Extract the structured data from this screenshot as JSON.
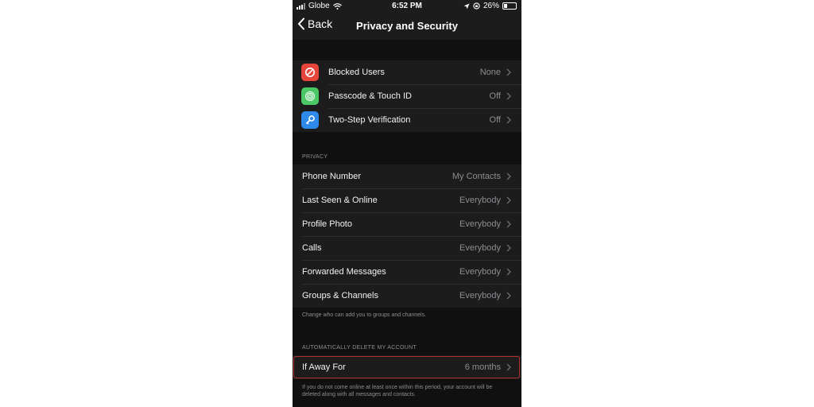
{
  "status_bar": {
    "carrier": "Globe",
    "time": "6:52 PM",
    "battery": "26%",
    "battery_level": 0.26
  },
  "nav": {
    "back_label": "Back",
    "title": "Privacy and Security"
  },
  "security": [
    {
      "label": "Blocked Users",
      "value": "None",
      "icon": "block-icon",
      "color": "#e5453b"
    },
    {
      "label": "Passcode & Touch ID",
      "value": "Off",
      "icon": "fingerprint-icon",
      "color": "#4cc765"
    },
    {
      "label": "Two-Step Verification",
      "value": "Off",
      "icon": "key-icon",
      "color": "#2f89ea"
    }
  ],
  "privacy": {
    "header": "PRIVACY",
    "items": [
      {
        "label": "Phone Number",
        "value": "My Contacts"
      },
      {
        "label": "Last Seen & Online",
        "value": "Everybody"
      },
      {
        "label": "Profile Photo",
        "value": "Everybody"
      },
      {
        "label": "Calls",
        "value": "Everybody"
      },
      {
        "label": "Forwarded Messages",
        "value": "Everybody"
      },
      {
        "label": "Groups & Channels",
        "value": "Everybody"
      }
    ],
    "footer": "Change who can add you to groups and channels."
  },
  "delete_account": {
    "header": "AUTOMATICALLY DELETE MY ACCOUNT",
    "label": "If Away For",
    "value": "6 months",
    "footer": "If you do not come online at least once within this period, your account will be deleted along with all messages and contacts."
  },
  "colors": {
    "highlight": "#b03030",
    "accent": "#2f89ea"
  }
}
